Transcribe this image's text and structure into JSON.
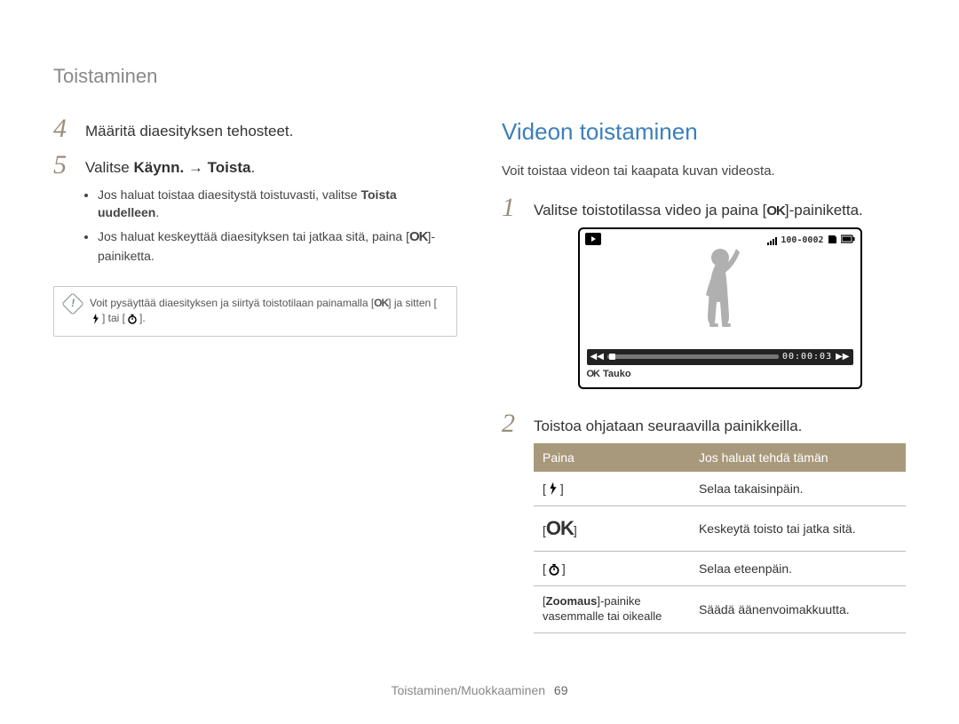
{
  "header": {
    "title": "Toistaminen"
  },
  "left": {
    "steps": [
      {
        "num": "4",
        "text": "Määritä diaesityksen tehosteet."
      },
      {
        "num": "5",
        "pre": "Valitse ",
        "bold1": "Käynn.",
        "arrow": " → ",
        "bold2": "Toista",
        "post": "."
      }
    ],
    "bullets": [
      {
        "pre": "Jos haluat toistaa diaesitystä toistuvasti, valitse ",
        "bold": "Toista uudelleen",
        "post": "."
      },
      {
        "text_pre": "Jos haluat keskeyttää diaesityksen tai jatkaa sitä, paina [",
        "ok": "OK",
        "text_post": "]-painiketta."
      }
    ],
    "note": {
      "text_pre": "Voit pysäyttää diaesityksen ja siirtyä toistotilaan painamalla [",
      "ok": "OK",
      "text_mid": "] ja sitten [",
      "or": "] tai [",
      "text_post": "]."
    }
  },
  "right": {
    "heading": "Videon toistaminen",
    "subtext": "Voit toistaa videon tai kaapata kuvan videosta.",
    "steps": [
      {
        "num": "1",
        "text_pre": "Valitse toistotilassa video ja paina [",
        "ok": "OK",
        "text_post": "]-painiketta."
      },
      {
        "num": "2",
        "text": "Toistoa ohjataan seuraavilla painikkeilla."
      }
    ],
    "preview": {
      "counter": "100-0002",
      "time": "00:00:03",
      "pause_label": "Tauko",
      "ok": "OK"
    },
    "table": {
      "head": {
        "col1": "Paina",
        "col2": "Jos haluat tehdä tämän"
      },
      "rows": [
        {
          "label_action": "Selaa takaisinpäin."
        },
        {
          "ok": "OK",
          "label_action": "Keskeytä toisto tai jatka sitä."
        },
        {
          "label_action": "Selaa eteenpäin."
        },
        {
          "zoom_bold": "Zoomaus",
          "zoom_rest": "-painike vasemmalle tai oikealle",
          "label_action": "Säädä äänenvoimakkuutta."
        }
      ]
    }
  },
  "footer": {
    "section": "Toistaminen/Muokkaaminen",
    "page": "69"
  }
}
